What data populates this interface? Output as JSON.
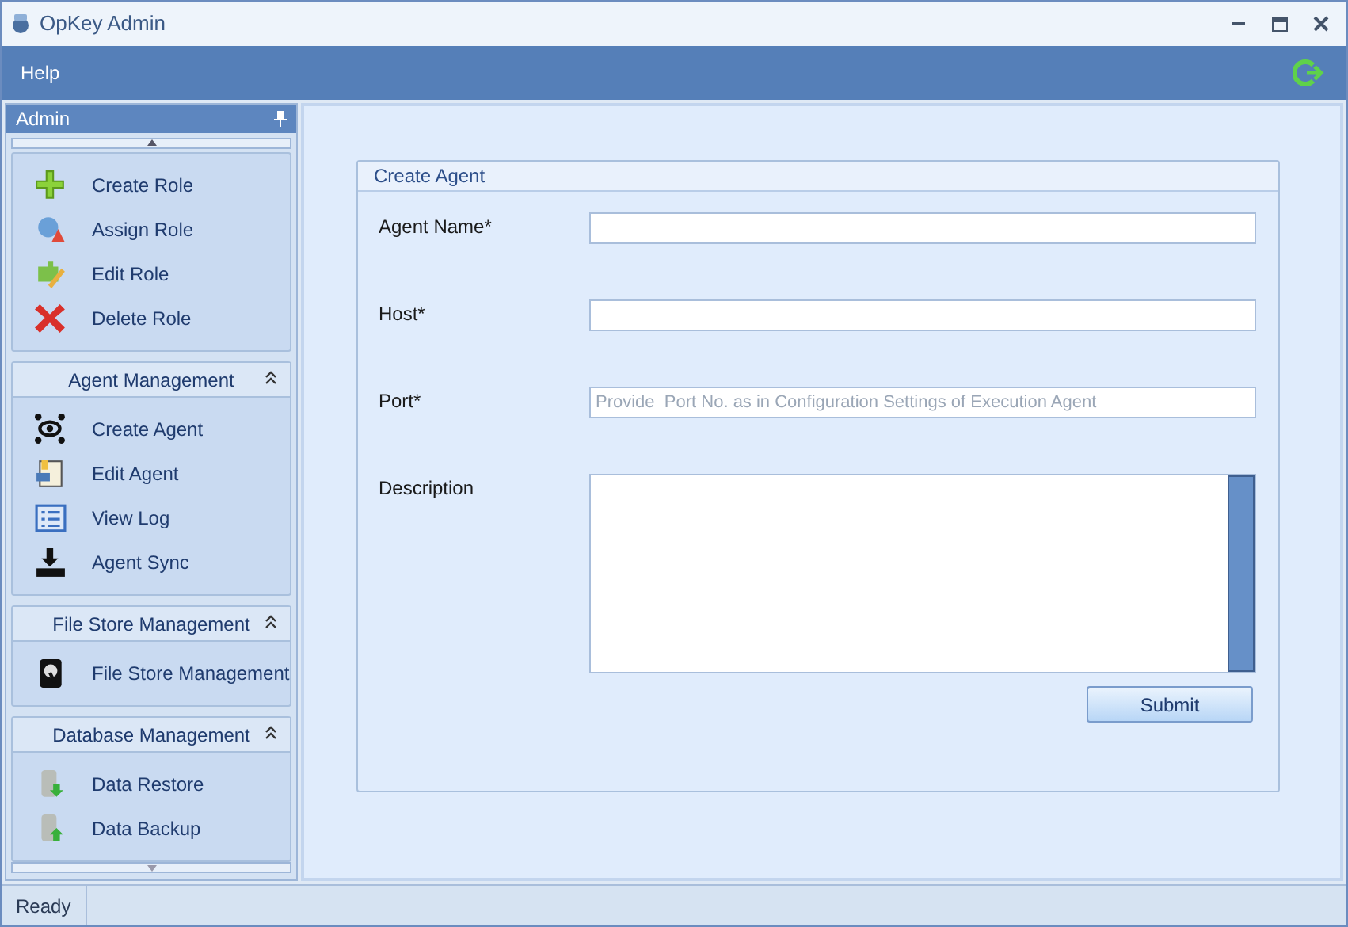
{
  "window": {
    "title": "OpKey Admin"
  },
  "menu": [
    "Help"
  ],
  "sidebar": {
    "title": "Admin",
    "groups": [
      {
        "items": [
          {
            "label": "Create Role",
            "kind": "plus"
          },
          {
            "label": "Assign Role",
            "kind": "assign"
          },
          {
            "label": "Edit Role",
            "kind": "puzzle"
          },
          {
            "label": "Delete Role",
            "kind": "cross"
          }
        ]
      },
      {
        "title": "Agent Management",
        "expanded": true,
        "items": [
          {
            "label": "Create Agent",
            "kind": "eye"
          },
          {
            "label": "Edit Agent",
            "kind": "doc"
          },
          {
            "label": "View Log",
            "kind": "list"
          },
          {
            "label": "Agent Sync",
            "kind": "download"
          }
        ]
      },
      {
        "title": "File Store Management",
        "expanded": true,
        "items": [
          {
            "label": "File Store Management",
            "kind": "disk"
          }
        ]
      },
      {
        "title": "Database Management",
        "expanded": true,
        "items": [
          {
            "label": "Data Restore",
            "kind": "db-down"
          },
          {
            "label": "Data Backup",
            "kind": "db-up"
          }
        ]
      }
    ]
  },
  "form": {
    "title": "Create Agent",
    "fields": [
      {
        "label": "Agent Name*",
        "kind": "text"
      },
      {
        "label": "Host*",
        "kind": "text"
      },
      {
        "label": "Port*",
        "kind": "text",
        "placeholder": "Provide  Port No. as in Configuration Settings of Execution Agent"
      },
      {
        "label": "Description",
        "kind": "textarea"
      }
    ],
    "button": "Submit"
  },
  "status_bar": {
    "text": "Ready"
  }
}
